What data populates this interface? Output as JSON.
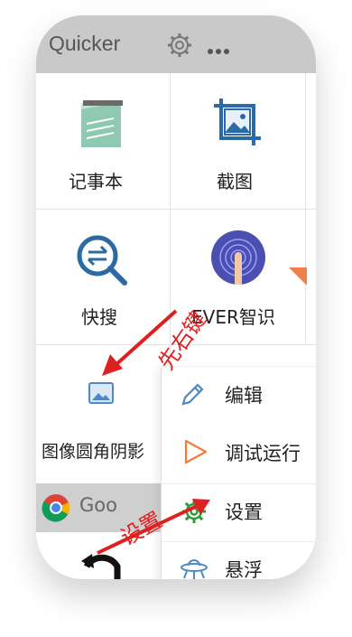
{
  "app": {
    "title": "Quicker"
  },
  "actions": [
    {
      "label": "记事本",
      "icon": "notepad-icon"
    },
    {
      "label": "截图",
      "icon": "crop-image-icon"
    },
    {
      "label": "快搜",
      "icon": "search-swap-icon"
    },
    {
      "label": "EVER智识",
      "icon": "fingerprint-icon"
    },
    {
      "label": "图像圆角阴影",
      "icon": "image-icon"
    }
  ],
  "chrome_item": {
    "label": "Goo",
    "icon": "chrome-icon"
  },
  "context_menu": [
    {
      "label": "编辑",
      "icon": "pencil-icon"
    },
    {
      "label": "调试运行",
      "icon": "play-icon"
    },
    {
      "label": "设置",
      "icon": "gear-icon"
    },
    {
      "label": "悬浮",
      "icon": "ufo-icon"
    }
  ],
  "annotations": {
    "right_click": "先右键",
    "settings": "设置"
  },
  "colors": {
    "topbar": "#c9c9c9",
    "accent": "#e02020",
    "ribbon": "#f0804a"
  }
}
